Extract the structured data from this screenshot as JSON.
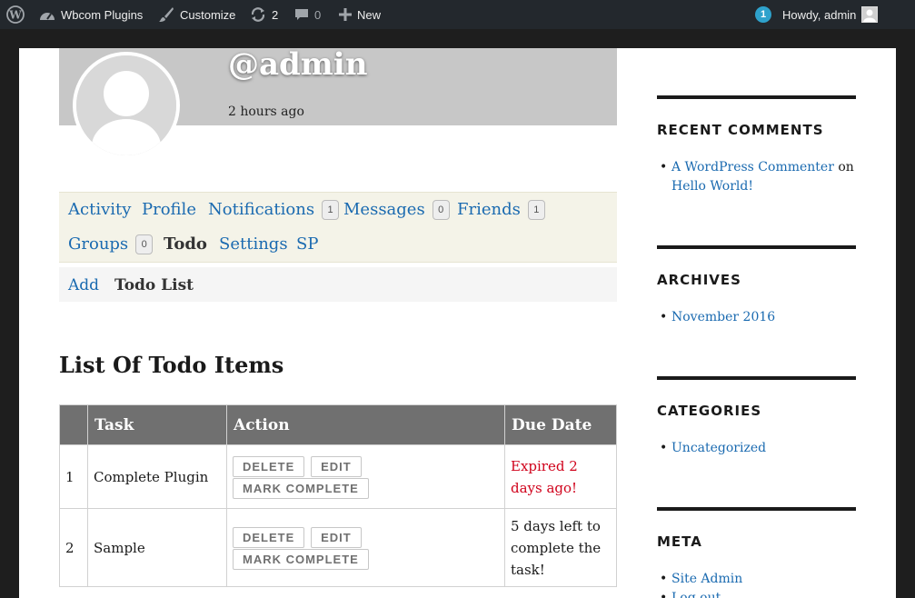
{
  "adminbar": {
    "site_name": "Wbcom Plugins",
    "customize": "Customize",
    "updates_count": "2",
    "comments_count": "0",
    "new_label": "New",
    "notification_count": "1",
    "howdy": "Howdy, admin"
  },
  "profile": {
    "username": "@admin",
    "last_active": "2 hours ago"
  },
  "primary_nav": {
    "activity": "Activity",
    "profile": "Profile",
    "notifications": "Notifications",
    "notifications_count": "1",
    "messages": "Messages",
    "messages_count": "0",
    "friends": "Friends",
    "friends_count": "1",
    "groups": "Groups",
    "groups_count": "0",
    "todo": "Todo",
    "settings": "Settings",
    "sp": "SP"
  },
  "sub_nav": {
    "add": "Add",
    "todo_list": "Todo List"
  },
  "main": {
    "heading": "List Of Todo Items",
    "table": {
      "headers": [
        "",
        "Task",
        "Action",
        "Due Date"
      ],
      "rows": [
        {
          "num": "1",
          "task": "Complete Plugin",
          "due": "Expired 2 days ago!"
        },
        {
          "num": "2",
          "task": "Sample",
          "due": "5 days left to complete the task!"
        }
      ],
      "actions": {
        "delete": "DELETE",
        "edit": "EDIT",
        "complete": "MARK COMPLETE"
      }
    }
  },
  "sidebar": {
    "recent_comments": {
      "title": "RECENT COMMENTS",
      "author": "A WordPress Commenter",
      "on": "on",
      "post": "Hello World!"
    },
    "archives": {
      "title": "ARCHIVES",
      "items": [
        "November 2016"
      ]
    },
    "categories": {
      "title": "CATEGORIES",
      "items": [
        "Uncategorized"
      ]
    },
    "meta": {
      "title": "META",
      "items": [
        "Site Admin",
        "Log out"
      ]
    }
  },
  "colors": {
    "link": "#1a6ab0",
    "adminbar_bg": "#23282d",
    "expired": "#d0021b",
    "table_header": "#707070"
  }
}
